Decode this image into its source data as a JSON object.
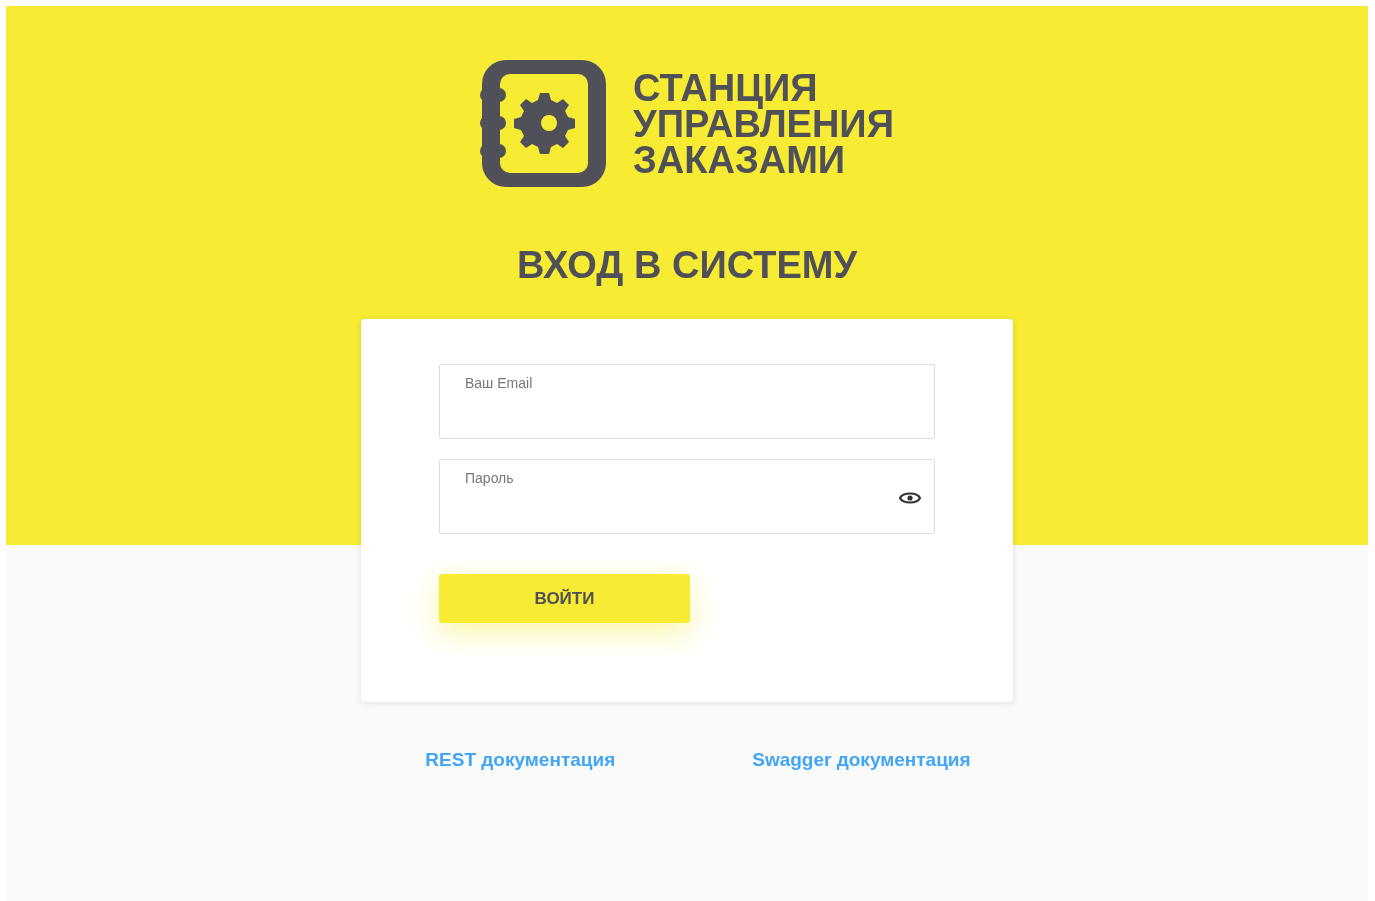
{
  "logo": {
    "lines": [
      "СТАНЦИЯ",
      "УПРАВЛЕНИЯ",
      "ЗАКАЗАМИ"
    ]
  },
  "heading": "ВХОД В СИСТЕМУ",
  "form": {
    "fields": [
      {
        "kind": "email",
        "placeholder": "Ваш Email"
      },
      {
        "kind": "password",
        "placeholder": "Пароль"
      }
    ],
    "submit": "ВОЙТИ"
  },
  "links": [
    "REST документация",
    "Swagger документация"
  ]
}
